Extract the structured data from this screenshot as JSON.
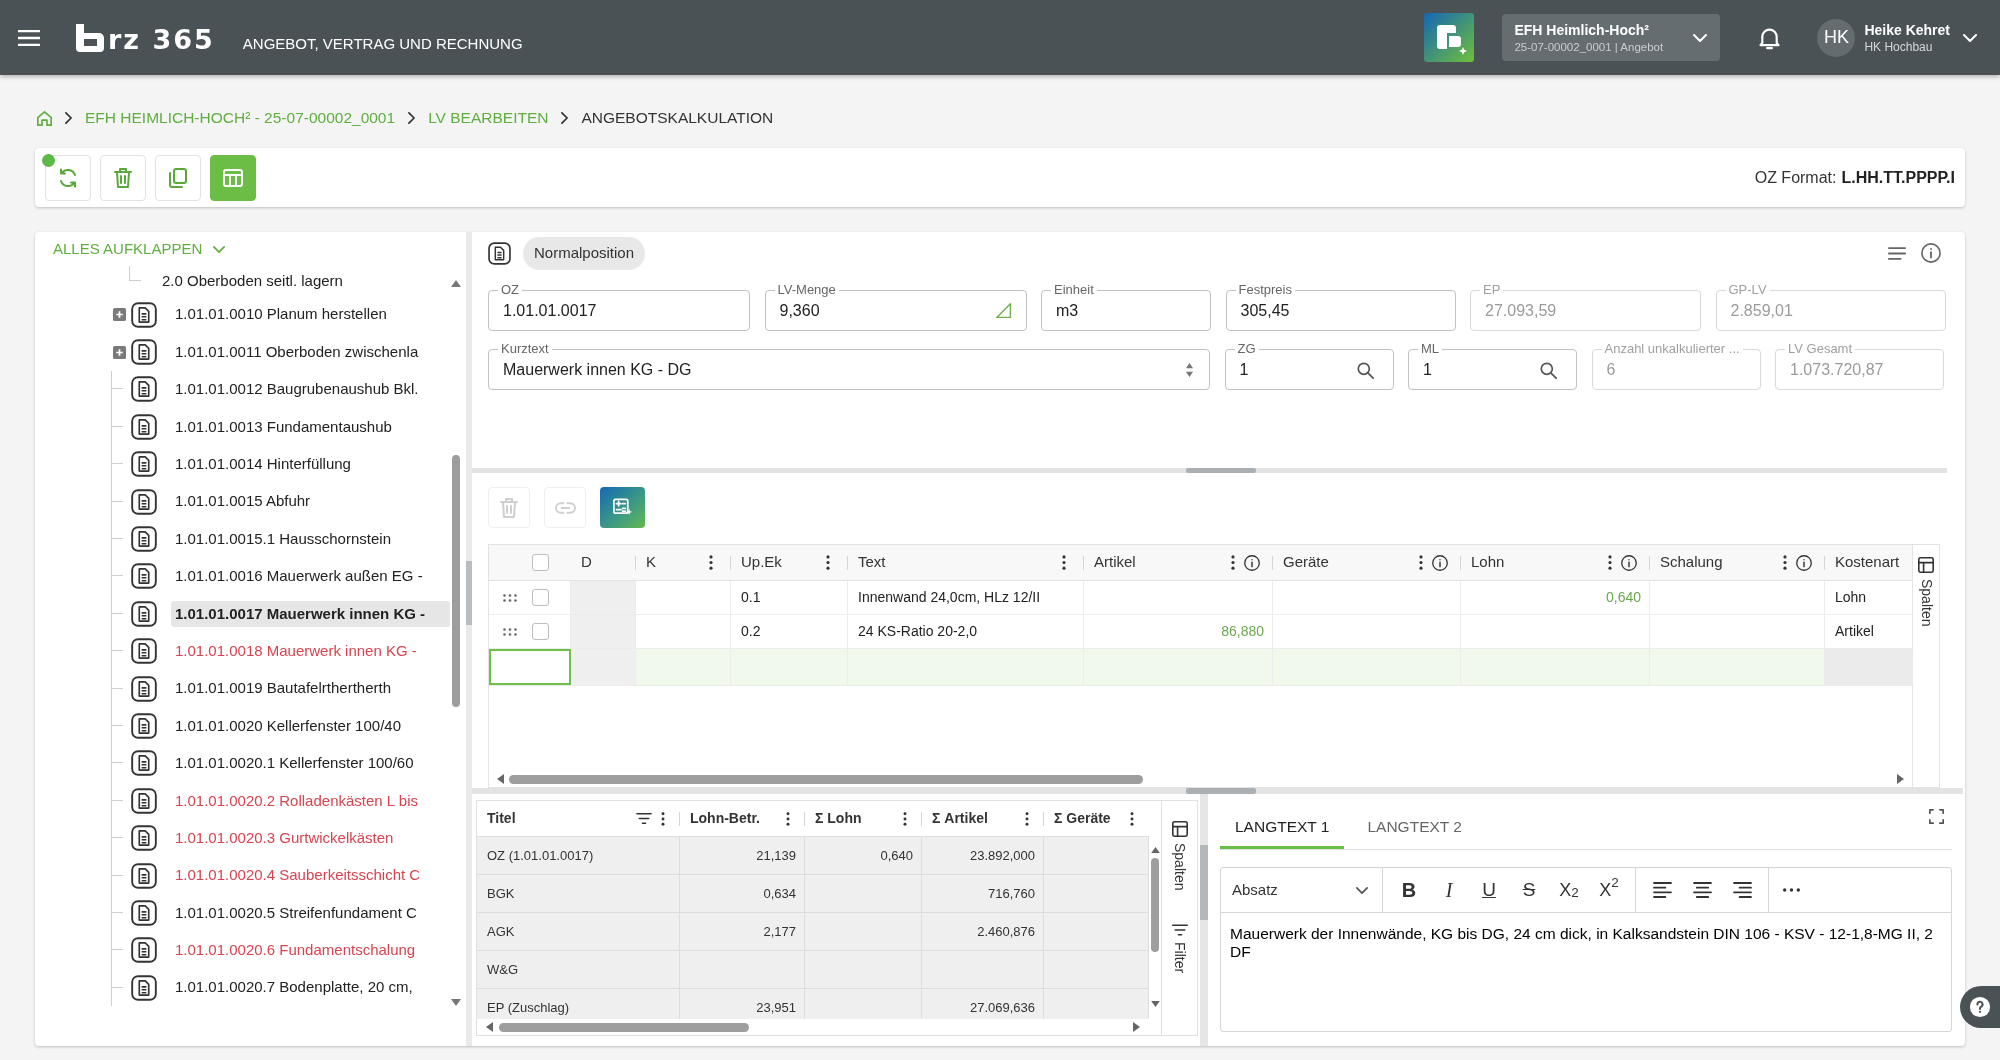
{
  "header": {
    "logo_text": "rz 365",
    "app_title": "ANGEBOT, VERTRAG UND RECHNUNG",
    "project": {
      "title": "EFH Heimlich-Hoch²",
      "subtitle": "25-07-00002_0001 | Angebot"
    },
    "user": {
      "initials": "HK",
      "name": "Heike Kehret",
      "company": "HK Hochbau"
    }
  },
  "breadcrumb": [
    {
      "label": "EFH HEIMLICH-HOCH² - 25-07-00002_0001",
      "current": false
    },
    {
      "label": "LV BEARBEITEN",
      "current": false
    },
    {
      "label": "ANGEBOTSKALKULATION",
      "current": true
    }
  ],
  "toolbar": {
    "buttons": [
      {
        "kind": "refresh",
        "selected": false
      },
      {
        "kind": "delete",
        "selected": false
      },
      {
        "kind": "copy",
        "selected": false
      },
      {
        "kind": "table",
        "selected": true
      }
    ],
    "oz_format_label": "OZ Format:",
    "oz_format": "L.HH.TT.PPPP.I"
  },
  "tree": {
    "expand_all": "ALLES AUFKLAPPEN",
    "items": [
      {
        "kind": "text",
        "label": "2.0 Oberboden seitl. lagern",
        "selected": false,
        "flagged": false,
        "has_children": false
      },
      {
        "kind": "position",
        "label": "1.01.01.0010 Planum herstellen",
        "selected": false,
        "flagged": false,
        "has_children": true
      },
      {
        "kind": "position",
        "label": "1.01.01.0011 Oberboden zwischenla",
        "selected": false,
        "flagged": false,
        "has_children": true
      },
      {
        "kind": "position",
        "label": "1.01.01.0012 Baugrubenaushub Bkl.",
        "selected": false,
        "flagged": false,
        "has_children": false
      },
      {
        "kind": "position",
        "label": "1.01.01.0013 Fundamentaushub",
        "selected": false,
        "flagged": false,
        "has_children": false
      },
      {
        "kind": "position",
        "label": "1.01.01.0014 Hinterfüllung",
        "selected": false,
        "flagged": false,
        "has_children": false
      },
      {
        "kind": "position",
        "label": "1.01.01.0015 Abfuhr",
        "selected": false,
        "flagged": false,
        "has_children": false
      },
      {
        "kind": "position",
        "label": "1.01.01.0015.1 Hausschornstein",
        "selected": false,
        "flagged": false,
        "has_children": false
      },
      {
        "kind": "position",
        "label": "1.01.01.0016 Mauerwerk außen EG -",
        "selected": false,
        "flagged": false,
        "has_children": false
      },
      {
        "kind": "position",
        "label": "1.01.01.0017 Mauerwerk innen KG -",
        "selected": true,
        "flagged": false,
        "has_children": false
      },
      {
        "kind": "position",
        "label": "1.01.01.0018 Mauerwerk innen KG -",
        "selected": false,
        "flagged": true,
        "has_children": false
      },
      {
        "kind": "position",
        "label": "1.01.01.0019 Bautafelrthertherth",
        "selected": false,
        "flagged": false,
        "has_children": false
      },
      {
        "kind": "position",
        "label": "1.01.01.0020 Kellerfenster 100/40",
        "selected": false,
        "flagged": false,
        "has_children": false
      },
      {
        "kind": "position",
        "label": "1.01.01.0020.1 Kellerfenster 100/60",
        "selected": false,
        "flagged": false,
        "has_children": false
      },
      {
        "kind": "position",
        "label": "1.01.01.0020.2 Rolladenkästen L bis",
        "selected": false,
        "flagged": true,
        "has_children": false
      },
      {
        "kind": "position",
        "label": "1.01.01.0020.3 Gurtwickelkästen",
        "selected": false,
        "flagged": true,
        "has_children": false
      },
      {
        "kind": "position",
        "label": "1.01.01.0020.4 Sauberkeitsschicht C",
        "selected": false,
        "flagged": true,
        "has_children": false
      },
      {
        "kind": "position",
        "label": "1.01.01.0020.5 Streifenfundament C",
        "selected": false,
        "flagged": false,
        "has_children": false
      },
      {
        "kind": "position",
        "label": "1.01.01.0020.6 Fundamentschalung",
        "selected": false,
        "flagged": true,
        "has_children": false
      },
      {
        "kind": "position",
        "label": "1.01.01.0020.7 Bodenplatte, 20 cm,",
        "selected": false,
        "flagged": false,
        "has_children": false
      }
    ]
  },
  "position": {
    "type_label": "Normalposition",
    "field_rows": [
      [
        {
          "label": "OZ",
          "value": "1.01.01.0017",
          "kind": "text",
          "disabled": false
        },
        {
          "label": "LV-Menge",
          "value": "9,360",
          "kind": "measure",
          "disabled": false
        },
        {
          "label": "Einheit",
          "value": "m3",
          "kind": "text",
          "disabled": false
        },
        {
          "label": "Festpreis",
          "value": "305,45",
          "kind": "text",
          "disabled": false
        },
        {
          "label": "EP",
          "value": "27.093,59",
          "kind": "text",
          "disabled": true
        },
        {
          "label": "GP-LV",
          "value": "2.859,01",
          "kind": "text",
          "disabled": true
        }
      ],
      [
        {
          "label": "Kurztext",
          "value": "Mauerwerk innen KG - DG",
          "kind": "select",
          "disabled": false
        },
        {
          "label": "ZG",
          "value": "1",
          "kind": "lookup",
          "disabled": false
        },
        {
          "label": "ML",
          "value": "1",
          "kind": "lookup",
          "disabled": false
        },
        {
          "label": "Anzahl unkalkulierter ...",
          "value": "6",
          "kind": "text",
          "disabled": true
        },
        {
          "label": "LV Gesamt",
          "value": "1.073.720,87",
          "kind": "text",
          "disabled": true
        }
      ]
    ]
  },
  "calc_grid": {
    "tools": [
      {
        "kind": "delete",
        "disabled": true
      },
      {
        "kind": "link",
        "disabled": true
      },
      {
        "kind": "ai",
        "disabled": false
      }
    ],
    "header_checked": false,
    "columns": [
      {
        "label": "D",
        "kind": "locked",
        "menu": false,
        "info": false
      },
      {
        "label": "K",
        "kind": "text",
        "menu": true,
        "info": false
      },
      {
        "label": "Up.Ek",
        "kind": "text",
        "menu": true,
        "info": false
      },
      {
        "label": "Text",
        "kind": "text",
        "menu": true,
        "info": false
      },
      {
        "label": "Artikel",
        "kind": "amount",
        "menu": true,
        "info": true
      },
      {
        "label": "Geräte",
        "kind": "amount",
        "menu": true,
        "info": true
      },
      {
        "label": "Lohn",
        "kind": "amount",
        "menu": true,
        "info": true
      },
      {
        "label": "Schalung",
        "kind": "amount",
        "menu": true,
        "info": true
      },
      {
        "label": "Kostenart",
        "kind": "category",
        "menu": false,
        "info": false
      }
    ],
    "rows": [
      {
        "kind": "data",
        "checked": false,
        "selected": false,
        "cells": [
          null,
          null,
          "0.1",
          "Innenwand 24,0cm, HLz 12/II",
          null,
          null,
          "0,640",
          null,
          "Lohn"
        ]
      },
      {
        "kind": "data",
        "checked": false,
        "selected": false,
        "cells": [
          null,
          null,
          "0.2",
          "24 KS-Ratio 20-2,0",
          "86,880",
          null,
          null,
          null,
          "Artikel"
        ]
      },
      {
        "kind": "new",
        "selected": true
      }
    ],
    "side_tab": "Spalten"
  },
  "summary": {
    "columns": [
      {
        "label": "Titel",
        "kind": "text",
        "filter": true
      },
      {
        "label": "Lohn-Betr.",
        "kind": "amount",
        "filter": false
      },
      {
        "label": "Σ Lohn",
        "kind": "amount",
        "filter": false
      },
      {
        "label": "Σ Artikel",
        "kind": "amount",
        "filter": false
      },
      {
        "label": "Σ Geräte",
        "kind": "amount",
        "filter": false
      }
    ],
    "rows": [
      {
        "cells": [
          "OZ (1.01.01.0017)",
          "21,139",
          "0,640",
          "23.892,000"
        ]
      },
      {
        "cells": [
          "BGK",
          "0,634",
          null,
          "716,760"
        ]
      },
      {
        "cells": [
          "AGK",
          "2,177",
          null,
          "2.460,876"
        ]
      },
      {
        "cells": [
          "W&G"
        ]
      },
      {
        "cells": [
          "EP (Zuschlag)",
          "23,951",
          null,
          "27.069,636"
        ]
      }
    ],
    "side_tabs": [
      {
        "kind": "columns",
        "label": "Spalten"
      },
      {
        "kind": "filter",
        "label": "Filter"
      }
    ]
  },
  "langtext": {
    "tabs": [
      {
        "label": "LANGTEXT 1",
        "selected": true
      },
      {
        "label": "LANGTEXT 2",
        "selected": false
      }
    ],
    "block_format": "Absatz",
    "format_buttons": [
      {
        "kind": "bold",
        "glyph": "B"
      },
      {
        "kind": "italic",
        "glyph": "I"
      },
      {
        "kind": "underline",
        "glyph": "U"
      },
      {
        "kind": "strike",
        "glyph": "S"
      },
      {
        "kind": "subscript",
        "glyph": "X$_{2}$"
      },
      {
        "kind": "superscript",
        "glyph": "X$^{2}$"
      }
    ],
    "align_buttons": [
      {
        "kind": "left"
      },
      {
        "kind": "center"
      },
      {
        "kind": "right"
      }
    ],
    "text": "Mauerwerk der Innenwände, KG bis DG, 24 cm dick, in Kalksandstein DIN 106 - KSV - 12-1,8-MG II, 2 DF"
  }
}
